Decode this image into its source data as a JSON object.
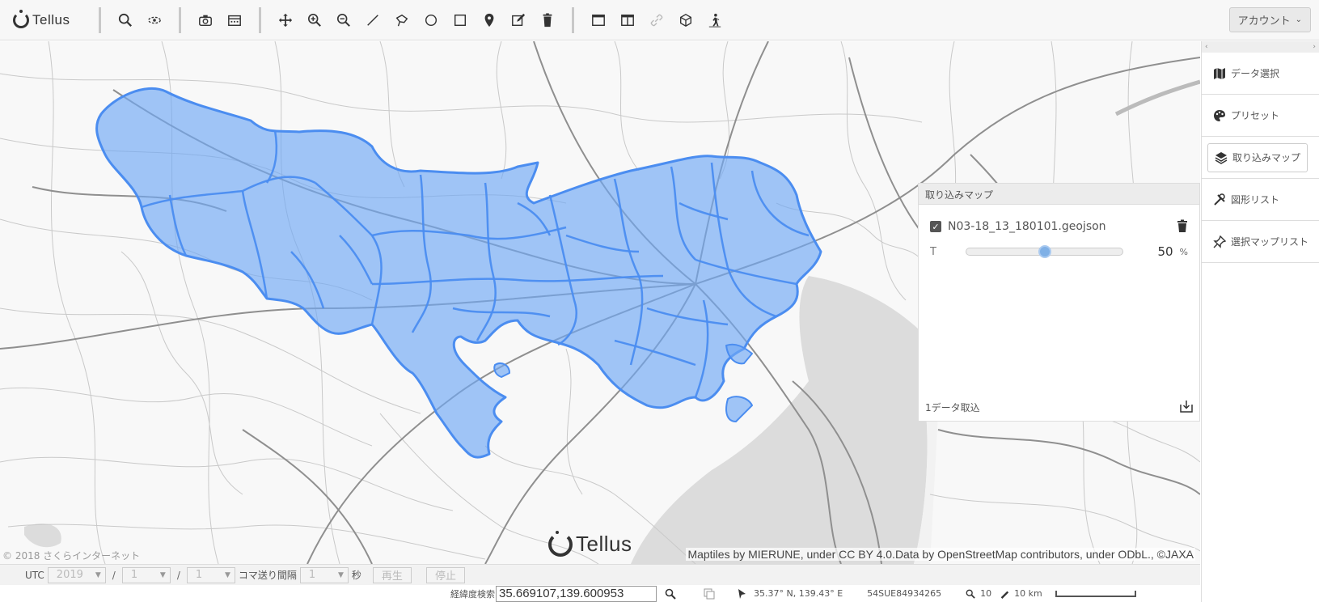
{
  "app": {
    "name": "Tellus"
  },
  "toolbar": {
    "groups": [
      [
        "search-icon",
        "orbit-icon"
      ],
      [
        "camera-icon",
        "calendar-icon"
      ],
      [
        "pan-icon",
        "zoom-in-icon",
        "zoom-out-icon",
        "line-icon",
        "polygon-icon",
        "circle-icon",
        "rectangle-icon",
        "pin-icon",
        "edit-icon",
        "trash-icon"
      ],
      [
        "window-icon",
        "split-window-icon",
        "link-icon",
        "cube-icon",
        "walker-icon"
      ]
    ],
    "account_label": "アカウント"
  },
  "map": {
    "copyright": "© 2018 さくらインターネット",
    "attribution": "Maptiles by MIERUNE, under CC BY 4.0.Data by OpenStreetMap contributors, under ODbL., ©JAXA",
    "overlay_color": "#6fa8f5",
    "overlay_border": "#4b8df0"
  },
  "layer_panel": {
    "title": "取り込みマップ",
    "layer_name": "N03-18_13_180101.geojson",
    "checked": true,
    "opacity_label": "T",
    "opacity_value": "50",
    "opacity_fraction": 0.5,
    "opacity_unit": "%",
    "footer_text": "1データ取込"
  },
  "sidebar": {
    "items": [
      {
        "label": "データ選択",
        "icon": "map-icon"
      },
      {
        "label": "プリセット",
        "icon": "palette-icon"
      },
      {
        "label": "取り込みマップ",
        "icon": "layers-icon"
      },
      {
        "label": "図形リスト",
        "icon": "tools-icon"
      },
      {
        "label": "選択マップリスト",
        "icon": "pin-list-icon"
      }
    ],
    "arrow_left": "‹",
    "arrow_right": "›"
  },
  "timebar": {
    "utc_label": "UTC",
    "year": "2019",
    "month": "1",
    "day": "1",
    "interval_label": "コマ送り間隔",
    "interval_value": "1",
    "seconds_label": "秒",
    "play_label": "再生",
    "stop_label": "停止"
  },
  "statusbar": {
    "coord_label": "経緯度検索",
    "coord_value": "35.669107,139.600953",
    "latlng": "35.37° N, 139.43° E",
    "mgrs": "54SUE84934265",
    "zoom": "10",
    "scale": "10 km"
  }
}
